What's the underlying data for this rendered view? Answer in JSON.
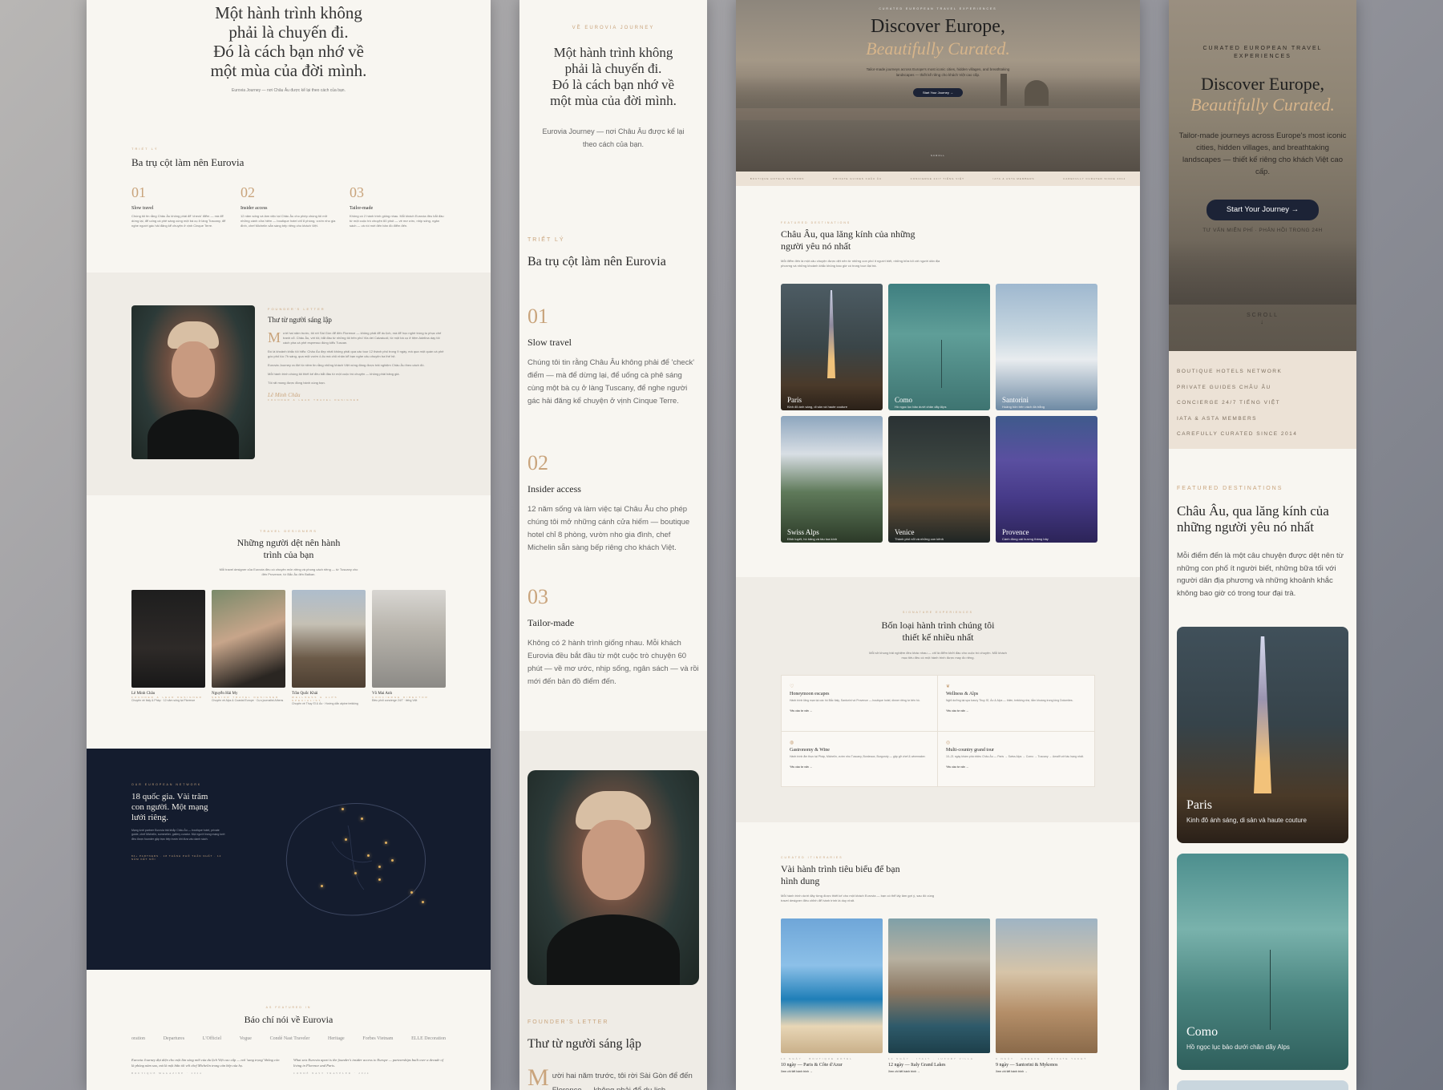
{
  "p1": {
    "hero_quote": [
      "Một hành trình không",
      "phải là chuyến đi.",
      "Đó là cách bạn nhớ về",
      "một mùa của đời mình."
    ],
    "hero_sub": "Eurovia Journey — nơi Châu Âu được kể lại theo cách của bạn.",
    "pillars_eyebrow": "TRIẾT LÝ",
    "pillars_title": "Ba trụ cột làm nên Eurovia",
    "pillars": [
      {
        "num": "01",
        "title": "Slow travel",
        "text": "Chúng tôi tin rằng Châu Âu không phải để 'check' điểm — mà để dừng lại, để uống cà phê sáng cùng một bà cụ ở làng Tuscany, để nghe người gác hải đăng kể chuyện ở vịnh Cinque Terre."
      },
      {
        "num": "02",
        "title": "Insider access",
        "text": "12 năm sống và làm việc tại Châu Âu cho phép chúng tôi mở những cánh cửa hiếm — boutique hotel chỉ 8 phòng, vườn nho gia đình, chef Michelin sẵn sàng bếp riêng cho khách Việt."
      },
      {
        "num": "03",
        "title": "Tailor-made",
        "text": "Không có 2 hành trình giống nhau. Mỗi khách Eurovia đều bắt đầu từ một cuộc trò chuyện 60 phút — về mơ ước, nhịp sống, ngân sách — và rồi mới đến bản đồ điểm đến."
      }
    ],
    "letter_eyebrow": "FOUNDER'S LETTER",
    "letter_title": "Thư từ người sáng lập",
    "letter_dropcap": "M",
    "letter_paras": [
      "ười hai năm trước, tôi rời Sài Gòn để đến Florence — không phải để du lịch, mà để học nghề trùng tu phục chế tranh cổ. Châu Âu, với tôi, bắt đầu từ những tôi trên phố Via dei Calzaiuoli, từ một bà cụ ở tiệm Adelina dạy tôi cách pha cà phê espresso đúng kiểu Tuscan.",
      "Đó là khoảnh khắc tôi hiểu: Châu Âu đẹp nhất không phải qua các tour 12 thành phố trong 9 ngày, mà qua một quán cà phê góc phố lúc 7h sáng, qua một vườn ô-liu mà chủ nhân kể bạn nghe câu chuyện ba thế hệ.",
      "Eurovia Journey ra đời từ niềm tin rằng những khách Việt xứng đáng được trải nghiệm Châu Âu theo cách đó.",
      "Mỗi hành trình chúng tôi thiết kế đều bắt đầu từ một cuộc trò chuyện — không phải bảng giá.",
      "Tôi rất mong được đồng hành cùng bạn."
    ],
    "letter_sign": "Lê Minh Châu",
    "letter_role": "FOUNDER & LEAD TRAVEL DESIGNER",
    "team_eyebrow": "TRAVEL DESIGNERS",
    "team_title": [
      "Những người dệt nên hành",
      "trình của bạn"
    ],
    "team_sub": "Mỗi travel designer của Eurovia đều có chuyên môn riêng và phong cách riêng — từ Tuscany cho đến Provence, từ Bắc Âu đến Balkan.",
    "team": [
      {
        "name": "Lê Minh Châu",
        "role": "FOUNDER & LEAD DESIGNER",
        "desc": "Chuyên về Italy & Pháp · 12 năm sống tại Florence"
      },
      {
        "name": "Nguyễn Hải My",
        "role": "SENIOR TRAVEL DESIGNER",
        "desc": "Chuyên về Alps & Coastal Europe · Cựu journalist Athens"
      },
      {
        "name": "Trần Quốc Khải",
        "role": "WELLNESS & ALPS SPECIALIST",
        "desc": "Chuyên về Thụy Sĩ & Áo · Hướng dẫn alpine trekking"
      },
      {
        "name": "Võ Mai Anh",
        "role": "CONCIERGE DIRECTOR",
        "desc": "Điều phối concierge 24/7 · tiếng Việt"
      }
    ],
    "network_eyebrow": "OUR EUROPEAN NETWORK",
    "network_title": [
      "18 quốc gia. Vài trăm",
      "con người. Một mạng",
      "lưới riêng."
    ],
    "network_text": "Mạng lưới partner Eurovia trải khắp Châu Âu — boutique hotel, private guide, chef Michelin, sommelier, gallery curator. Mọi người trong mạng lưới đều được founder gặp trực tiếp trước khi đưa vào danh sách.",
    "network_note": "84+ PARTNERS · 18 THÀNH PHỐ THÂN NHẤT · 12 NĂM KẾT NỐI",
    "press_eyebrow": "AS FEATURED IN",
    "press_title": "Báo chí nói về Eurovia",
    "press_logos": [
      "oration",
      "Departures",
      "L'Officiel",
      "Vogue",
      "Condé Nast Traveler",
      "Heritage",
      "Forbes Vietnam",
      "ELLE Decoration"
    ],
    "press_quotes": [
      {
        "text": "Eurovia Journey đại diện cho một làn sóng mới của du lịch Việt cao cấp — nơi 'sang trọng' không còn là phòng năm sao, mà là một bữa tối với chef Michelin trong căn bếp của họ.",
        "src": "BOUTIQUE MAGAZINE · 2024"
      },
      {
        "text": "What sets Eurovia apart is the founder's insider access to Europe — partnerships built over a decade of living in Florence and Paris.",
        "src": "CONDÉ NAST TRAVELER · 2024"
      }
    ]
  },
  "p2": {
    "eyebrow": "VỀ EUROVIA JOURNEY",
    "quote": [
      "Một hành trình không",
      "phải là chuyến đi.",
      "Đó là cách bạn nhớ về",
      "một mùa của đời mình."
    ],
    "sub": [
      "Eurovia Journey — nơi Châu Âu được kể lại",
      "theo cách của bạn."
    ],
    "pillars_eyebrow": "TRIẾT LÝ",
    "pillars_title": "Ba trụ cột làm nên Eurovia",
    "letter_eyebrow": "FOUNDER'S LETTER",
    "letter_title": "Thư từ người sáng lập",
    "letter_start": "ười hai năm trước, tôi rời Sài Gòn để đến Florence — không phải để du lịch"
  },
  "p3": {
    "hero_eyebrow": "CURATED EUROPEAN TRAVEL EXPERIENCES",
    "hero_title": "Discover Europe,",
    "hero_title2": "Beautifully Curated.",
    "hero_sub": "Tailor-made journeys across Europe's most iconic cities, hidden villages, and breathtaking landscapes — thiết kế riêng cho khách Việt cao cấp.",
    "hero_btn": "Start Your Journey",
    "scroll": "SCROLL",
    "badges": [
      "BOUTIQUE HOTELS NETWORK",
      "PRIVATE GUIDES CHÂU ÂU",
      "CONCIERGE 24/7 TIẾNG VIỆT",
      "IATA & ASTA MEMBERS",
      "CAREFULLY CURATED SINCE 2014"
    ],
    "dest_eyebrow": "FEATURED DESTINATIONS",
    "dest_title": [
      "Châu Âu, qua lăng kính của những",
      "người yêu nó nhất"
    ],
    "dest_sub": "Mỗi điểm đến là một câu chuyện được dệt nên từ những con phố ít người biết, những bữa tối với người dân địa phương và những khoảnh khắc không bao giờ có trong tour đại trà.",
    "destinations": [
      {
        "name": "Paris",
        "desc": "Kinh đô ánh sáng, di sản và haute couture"
      },
      {
        "name": "Como",
        "desc": "Hồ ngọc lục bảo dưới chân dãy Alps"
      },
      {
        "name": "Santorini",
        "desc": "Hoàng hôn trên vách đá trắng"
      },
      {
        "name": "Swiss Alps",
        "desc": "Đỉnh tuyết, hồ băng và tàu toa kính"
      },
      {
        "name": "Venice",
        "desc": "Thành phố nổi và những con kênh"
      },
      {
        "name": "Provence",
        "desc": "Cánh đồng oải hương tháng bảy"
      }
    ],
    "sig_eyebrow": "SIGNATURE EXPERIENCES",
    "sig_title": [
      "Bốn loại hành trình chúng tôi",
      "thiết kế nhiều nhất"
    ],
    "sig_sub": "Mỗi sở khung trải nghiệm đều khác nhau — chỉ là điểm khởi đầu cho cuộc trò chuyện. Mỗi khách mục tiêu đều có một hành trình được may đo riêng.",
    "sig": [
      {
        "title": "Honeymoon escapes",
        "text": "Hành trình lãng mạn tại các hồ Bắc Italy, Santorini và Provence — boutique hotel, dinner riêng tư bên hồ.",
        "cta": "Yêu cầu tư vấn →"
      },
      {
        "title": "Wellness & Alps",
        "text": "Nghỉ dưỡng tại spa luxury Thụy Sĩ, Áo & Alps — thiền, trekking nhẹ, tắm khoáng trong lòng Dolomites.",
        "cta": "Yêu cầu tư vấn →"
      },
      {
        "title": "Gastronomy & Wine",
        "text": "Hành trình ẩm thực tại Pháp, Michelin, vườn nho Tuscany, Bordeaux, Burgundy — gặp gỡ chef & winemaker.",
        "cta": "Yêu cầu tư vấn →"
      },
      {
        "title": "Multi-country grand tour",
        "text": "10–21 ngày khám phá nhiều Châu Âu — Paris → Swiss Alps → Como → Tuscany → Amalfi với tàu hạng nhất.",
        "cta": "Yêu cầu tư vấn →"
      }
    ],
    "itin_eyebrow": "CURATED ITINERARIES",
    "itin_title": [
      "Vài hành trình tiêu biểu để bạn",
      "hình dung"
    ],
    "itin_sub": "Mỗi hành trình dưới đây từng được thiết kế cho một khách Eurovia — bạn có thể lấy làm gợi ý, sau đó cùng travel designer điều chỉnh để hành trình là duy nhất.",
    "itins": [
      {
        "meta": "10 NGÀY · BOUTIQUE HOTEL",
        "title": "10 ngày — Paris & Côte d'Azur",
        "cta": "Xem chi tiết hành trình →"
      },
      {
        "meta": "12 NGÀY · ITALY · LUXURY VILLA",
        "title": "12 ngày — Italy Grand Lakes",
        "cta": "Xem chi tiết hành trình →"
      },
      {
        "meta": "9 NGÀY · GREECE · PRIVATE YACHT",
        "title": "9 ngày — Santorini & Mykonos",
        "cta": "Xem chi tiết hành trình →"
      }
    ]
  },
  "p4": {
    "hero_eyebrow": "CURATED EUROPEAN TRAVEL EXPERIENCES",
    "hero_title": "Discover Europe,",
    "hero_title2": "Beautifully Curated.",
    "hero_sub": "Tailor-made journeys across Europe's most iconic cities, hidden villages, and breathtaking landscapes — thiết kế riêng cho khách Việt cao cấp.",
    "hero_btn": "Start Your Journey",
    "hero_note": "TƯ VẤN MIỄN PHÍ · PHẢN HỒI TRONG 24H",
    "scroll": "SCROLL",
    "badges": [
      "BOUTIQUE HOTELS NETWORK",
      "PRIVATE GUIDES CHÂU ÂU",
      "CONCIERGE 24/7 TIẾNG VIỆT",
      "IATA & ASTA MEMBERS",
      "CAREFULLY CURATED SINCE 2014"
    ],
    "dest_eyebrow": "FEATURED DESTINATIONS",
    "dest_title": [
      "Châu Âu, qua lăng kính của",
      "những người yêu nó nhất"
    ],
    "dest_sub": "Mỗi điểm đến là một câu chuyện được dệt nên từ những con phố ít người biết, những bữa tối với người dân địa phương và những khoảnh khắc không bao giờ có trong tour đại trà.",
    "cards": [
      {
        "name": "Paris",
        "desc": "Kinh đô ánh sáng, di sản và haute couture"
      },
      {
        "name": "Como",
        "desc": "Hồ ngọc lục bảo dưới chân dãy Alps"
      }
    ]
  },
  "colors": {
    "accent": "#c9a47c",
    "navy": "#141c2e",
    "cream": "#f8f6f1"
  }
}
